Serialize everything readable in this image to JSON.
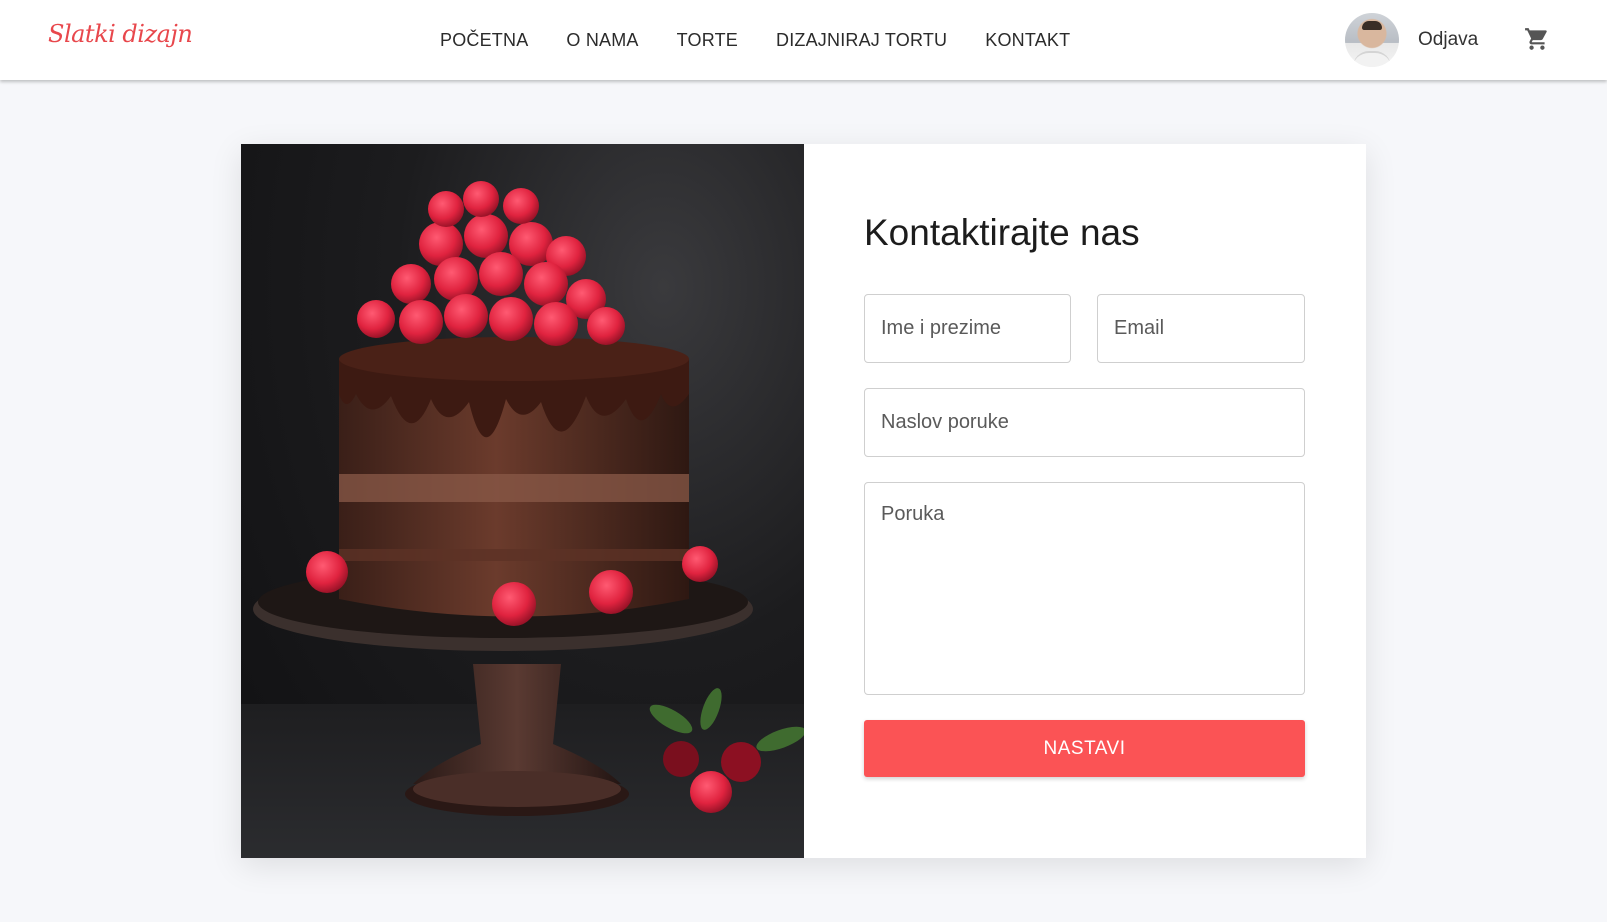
{
  "brand": {
    "logo_text": "Slatki dizajn",
    "accent_color": "#fb5355"
  },
  "nav": {
    "items": [
      {
        "label": "POČETNA"
      },
      {
        "label": "O NAMA"
      },
      {
        "label": "TORTE"
      },
      {
        "label": "DIZAJNIRAJ TORTU"
      },
      {
        "label": "KONTAKT"
      }
    ]
  },
  "user": {
    "avatar_icon": "user-avatar",
    "logout_label": "Odjava",
    "cart_icon": "shopping-cart-icon"
  },
  "contact": {
    "title": "Kontaktirajte nas",
    "image_subject": "chocolate-raspberry-cake",
    "fields": {
      "name_placeholder": "Ime i prezime",
      "email_placeholder": "Email",
      "subject_placeholder": "Naslov poruke",
      "message_placeholder": "Poruka"
    },
    "submit_label": "NASTAVI"
  }
}
